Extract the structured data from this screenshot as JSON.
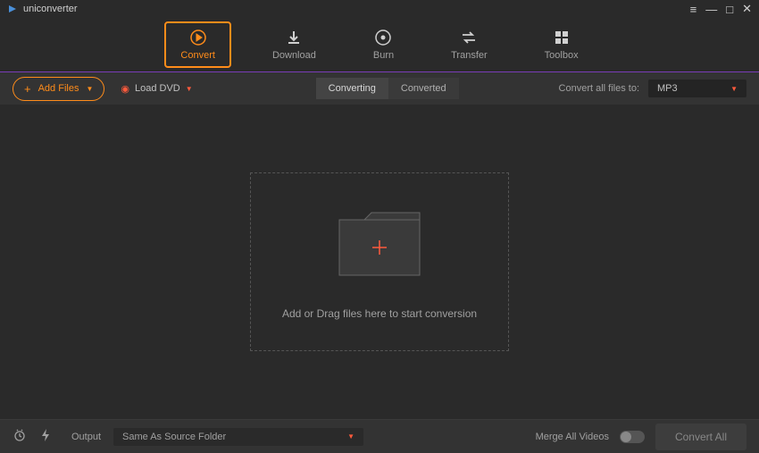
{
  "app": {
    "title": "uniconverter"
  },
  "nav": {
    "convert": "Convert",
    "download": "Download",
    "burn": "Burn",
    "transfer": "Transfer",
    "toolbox": "Toolbox"
  },
  "toolbar": {
    "add_files": "Add Files",
    "load_dvd": "Load DVD",
    "converting": "Converting",
    "converted": "Converted",
    "convert_to_label": "Convert all files to:",
    "format": "MP3"
  },
  "dropzone": {
    "text": "Add or Drag files here to start conversion"
  },
  "footer": {
    "output_label": "Output",
    "output_value": "Same As Source Folder",
    "merge_label": "Merge All Videos",
    "convert_all": "Convert All"
  }
}
